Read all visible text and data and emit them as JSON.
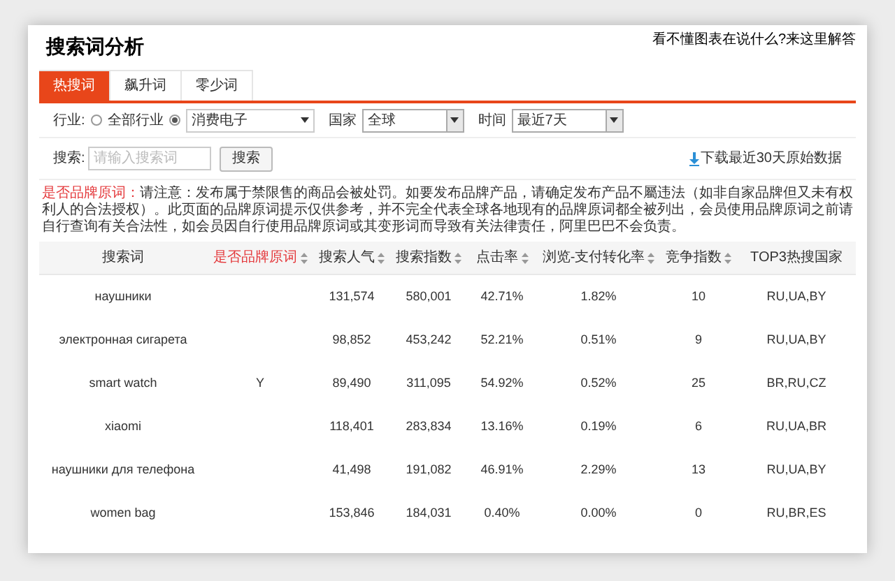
{
  "page": {
    "title": "搜索词分析",
    "help_link": "看不懂图表在说什么?来这里解答"
  },
  "tabs": [
    {
      "label": "热搜词",
      "selected": true
    },
    {
      "label": "飙升词",
      "selected": false
    },
    {
      "label": "零少词",
      "selected": false
    }
  ],
  "filters": {
    "industry_label": "行业:",
    "industry_options": [
      {
        "label": "全部行业",
        "selected": false
      },
      {
        "selected": true,
        "value": "消费电子"
      }
    ],
    "country_label": "国家",
    "country_value": "全球",
    "time_label": "时间",
    "time_value": "最近7天"
  },
  "search": {
    "label": "搜索:",
    "placeholder": "请输入搜索词",
    "button": "搜索",
    "download_link": "下载最近30天原始数据"
  },
  "notice": {
    "label": "是否品牌原词：",
    "text": "请注意：发布属于禁限售的商品会被处罚。如要发布品牌产品，请确定发布产品不屬违法（如非自家品牌但又未有权利人的合法授权）。此页面的品牌原词提示仅供参考，并不完全代表全球各地现有的品牌原词都全被列出，会员使用品牌原词之前请自行查询有关合法性，如会员因自行使用品牌原词或其变形词而导致有关法律责任，阿里巴巴不会负责。"
  },
  "table": {
    "columns": [
      {
        "label": "搜索词",
        "sortable": false,
        "highlighted": false
      },
      {
        "label": "是否品牌原词",
        "sortable": true,
        "highlighted": true
      },
      {
        "label": "搜索人气",
        "sortable": true,
        "highlighted": false
      },
      {
        "label": "搜索指数",
        "sortable": true,
        "highlighted": false
      },
      {
        "label": "点击率",
        "sortable": true,
        "highlighted": false
      },
      {
        "label": "浏览-支付转化率",
        "sortable": true,
        "highlighted": false
      },
      {
        "label": "竞争指数",
        "sortable": true,
        "highlighted": false
      },
      {
        "label": "TOP3热搜国家",
        "sortable": false,
        "highlighted": false
      }
    ],
    "rows": [
      [
        "наушники",
        "",
        "131,574",
        "580,001",
        "42.71%",
        "1.82%",
        "10",
        "RU,UA,BY"
      ],
      [
        "электронная сигарета",
        "",
        "98,852",
        "453,242",
        "52.21%",
        "0.51%",
        "9",
        "RU,UA,BY"
      ],
      [
        "smart watch",
        "Y",
        "89,490",
        "311,095",
        "54.92%",
        "0.52%",
        "25",
        "BR,RU,CZ"
      ],
      [
        "xiaomi",
        "",
        "118,401",
        "283,834",
        "13.16%",
        "0.19%",
        "6",
        "RU,UA,BR"
      ],
      [
        "наушники для телефона",
        "",
        "41,498",
        "191,082",
        "46.91%",
        "2.29%",
        "13",
        "RU,UA,BY"
      ],
      [
        "women bag",
        "",
        "153,846",
        "184,031",
        "0.40%",
        "0.00%",
        "0",
        "RU,BR,ES"
      ]
    ]
  }
}
